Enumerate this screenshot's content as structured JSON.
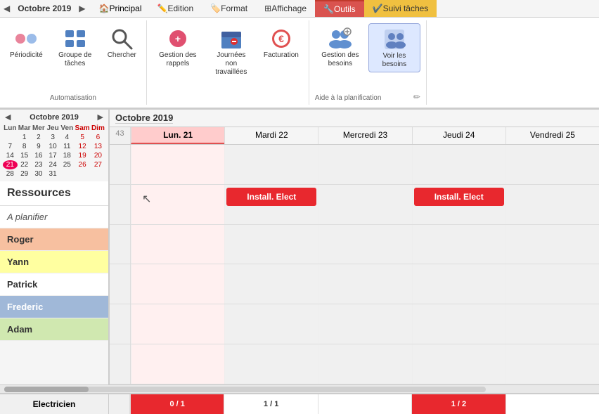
{
  "ribbon": {
    "nav_prev": "◀",
    "nav_next": "▶",
    "month_year": "Octobre 2019",
    "tabs": [
      {
        "id": "principal",
        "label": "Principal",
        "active": false,
        "icon": "🏠"
      },
      {
        "id": "edition",
        "label": "Edition",
        "active": false
      },
      {
        "id": "format",
        "label": "Format",
        "active": false
      },
      {
        "id": "affichage",
        "label": "Affichage",
        "active": false
      },
      {
        "id": "outils",
        "label": "Outils",
        "active": true,
        "highlight": "red"
      },
      {
        "id": "suivi",
        "label": "Suivi tâches",
        "active": false,
        "highlight": "yellow"
      }
    ],
    "sections": [
      {
        "id": "automatisation",
        "label": "Automatisation",
        "buttons": [
          {
            "id": "periodicite",
            "label": "Périodicité",
            "icon": "🔄"
          },
          {
            "id": "groupe-taches",
            "label": "Groupe de tâches",
            "icon": "📋"
          },
          {
            "id": "chercher",
            "label": "Chercher",
            "icon": "🔍"
          }
        ]
      },
      {
        "id": "gestion",
        "label": "",
        "buttons": [
          {
            "id": "gestion-rappels",
            "label": "Gestion des rappels",
            "icon": "🔔"
          },
          {
            "id": "journees-non-travaillees",
            "label": "Journées non travaillées",
            "icon": "📅"
          },
          {
            "id": "facturation",
            "label": "Facturation",
            "icon": "💰"
          }
        ]
      },
      {
        "id": "aide-planification",
        "label": "Aide à la planification",
        "buttons": [
          {
            "id": "gestion-besoins",
            "label": "Gestion des besoins",
            "icon": "👥"
          },
          {
            "id": "voir-besoins",
            "label": "Voir les besoins",
            "icon": "👤",
            "active": true
          }
        ]
      }
    ]
  },
  "mini_calendar": {
    "month": "Octobre 2019",
    "days_header": [
      "Lun",
      "Mar",
      "Mer",
      "Jeu",
      "Ven",
      "Sam",
      "Dim"
    ],
    "weeks": [
      [
        null,
        1,
        2,
        3,
        4,
        5,
        6
      ],
      [
        7,
        8,
        9,
        10,
        11,
        12,
        13
      ],
      [
        14,
        15,
        16,
        17,
        18,
        19,
        20
      ],
      [
        21,
        22,
        23,
        24,
        25,
        26,
        27
      ],
      [
        28,
        29,
        30,
        31,
        null,
        null,
        null
      ]
    ],
    "today": 21,
    "weekends": [
      5,
      6,
      12,
      13,
      19,
      20,
      26,
      27
    ]
  },
  "resources": {
    "title": "Ressources",
    "items": [
      {
        "id": "a-planifier",
        "label": "A planifier",
        "class": "a-planifier"
      },
      {
        "id": "roger",
        "label": "Roger",
        "class": "roger"
      },
      {
        "id": "yann",
        "label": "Yann",
        "class": "yann"
      },
      {
        "id": "patrick",
        "label": "Patrick",
        "class": "patrick"
      },
      {
        "id": "frederic",
        "label": "Frederic",
        "class": "frederic"
      },
      {
        "id": "adam",
        "label": "Adam",
        "class": "adam"
      }
    ]
  },
  "calendar": {
    "month_title": "Octobre 2019",
    "week_number": 43,
    "days": [
      {
        "label": "Lun. 21",
        "id": "lun21",
        "is_today": true
      },
      {
        "label": "Mardi 22",
        "id": "mar22",
        "is_today": false
      },
      {
        "label": "Mercredi 23",
        "id": "mer23",
        "is_today": false
      },
      {
        "label": "Jeudi 24",
        "id": "jeu24",
        "is_today": false
      },
      {
        "label": "Vendredi 25",
        "id": "ven25",
        "is_today": false
      }
    ],
    "tasks": [
      {
        "resource": "roger",
        "day": "mar22",
        "label": "Install. Elect",
        "color": "#e8282e"
      },
      {
        "resource": "roger",
        "day": "jeu24",
        "label": "Install. Elect",
        "color": "#e8282e"
      }
    ]
  },
  "footer": {
    "label": "Electricien",
    "cells": [
      {
        "day": "lun21",
        "value": "0 / 1",
        "type": "red"
      },
      {
        "day": "mar22",
        "value": "1 / 1",
        "type": "empty"
      },
      {
        "day": "mer23",
        "value": "",
        "type": "empty"
      },
      {
        "day": "jeu24",
        "value": "1 / 2",
        "type": "red"
      },
      {
        "day": "ven25",
        "value": "",
        "type": "empty"
      }
    ]
  }
}
